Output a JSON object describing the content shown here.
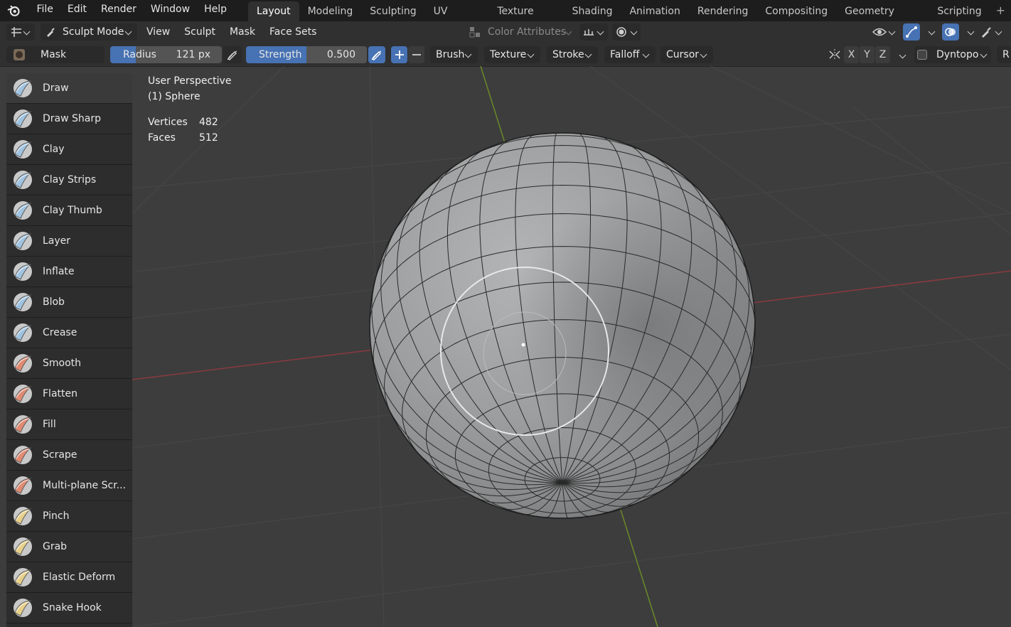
{
  "menubar": {
    "items": [
      "File",
      "Edit",
      "Render",
      "Window",
      "Help"
    ],
    "workspaces": [
      "Layout",
      "Modeling",
      "Sculpting",
      "UV Editing",
      "Texture Paint",
      "Shading",
      "Animation",
      "Rendering",
      "Compositing",
      "Geometry Nodes",
      "Scripting"
    ],
    "active_workspace": "Layout",
    "add_label": "+"
  },
  "header": {
    "mode": "Sculpt Mode",
    "menus": [
      "View",
      "Sculpt",
      "Mask",
      "Face Sets"
    ],
    "color_attributes": "Color Attributes"
  },
  "tool_header": {
    "brush_name": "Mask",
    "radius_label": "Radius",
    "radius_value": "121 px",
    "strength_label": "Strength",
    "strength_value": "0.500",
    "strength_fraction": 0.5,
    "dropdowns": [
      "Brush",
      "Texture",
      "Stroke",
      "Falloff",
      "Cursor"
    ],
    "axes": [
      "X",
      "Y",
      "Z"
    ],
    "dyntopo": "Dyntopo",
    "remesh_clip": "R"
  },
  "viewport": {
    "view_name": "User Perspective",
    "object": "(1) Sphere",
    "stats": [
      {
        "label": "Vertices",
        "value": "482"
      },
      {
        "label": "Faces",
        "value": "512"
      }
    ]
  },
  "tools": [
    {
      "name": "Draw",
      "icon": "draw-brush-icon",
      "color": "#9fc3e0"
    },
    {
      "name": "Draw Sharp",
      "icon": "draw-sharp-brush-icon",
      "color": "#9fc3e0"
    },
    {
      "name": "Clay",
      "icon": "clay-brush-icon",
      "color": "#9fc3e0"
    },
    {
      "name": "Clay Strips",
      "icon": "clay-strips-brush-icon",
      "color": "#9fc3e0"
    },
    {
      "name": "Clay Thumb",
      "icon": "clay-thumb-brush-icon",
      "color": "#9fc3e0"
    },
    {
      "name": "Layer",
      "icon": "layer-brush-icon",
      "color": "#9fc3e0"
    },
    {
      "name": "Inflate",
      "icon": "inflate-brush-icon",
      "color": "#9fc3e0"
    },
    {
      "name": "Blob",
      "icon": "blob-brush-icon",
      "color": "#9fc3e0"
    },
    {
      "name": "Crease",
      "icon": "crease-brush-icon",
      "color": "#9fc3e0"
    },
    {
      "name": "Smooth",
      "icon": "smooth-brush-icon",
      "color": "#e08a72"
    },
    {
      "name": "Flatten",
      "icon": "flatten-brush-icon",
      "color": "#e08a72"
    },
    {
      "name": "Fill",
      "icon": "fill-brush-icon",
      "color": "#e08a72"
    },
    {
      "name": "Scrape",
      "icon": "scrape-brush-icon",
      "color": "#e08a72"
    },
    {
      "name": "Multi-plane Scr...",
      "icon": "multiplane-scrape-brush-icon",
      "color": "#e08a72"
    },
    {
      "name": "Pinch",
      "icon": "pinch-brush-icon",
      "color": "#e8d08a"
    },
    {
      "name": "Grab",
      "icon": "grab-brush-icon",
      "color": "#e8d08a"
    },
    {
      "name": "Elastic Deform",
      "icon": "elastic-deform-brush-icon",
      "color": "#e8d08a"
    },
    {
      "name": "Snake Hook",
      "icon": "snake-hook-brush-icon",
      "color": "#e8d08a"
    }
  ]
}
